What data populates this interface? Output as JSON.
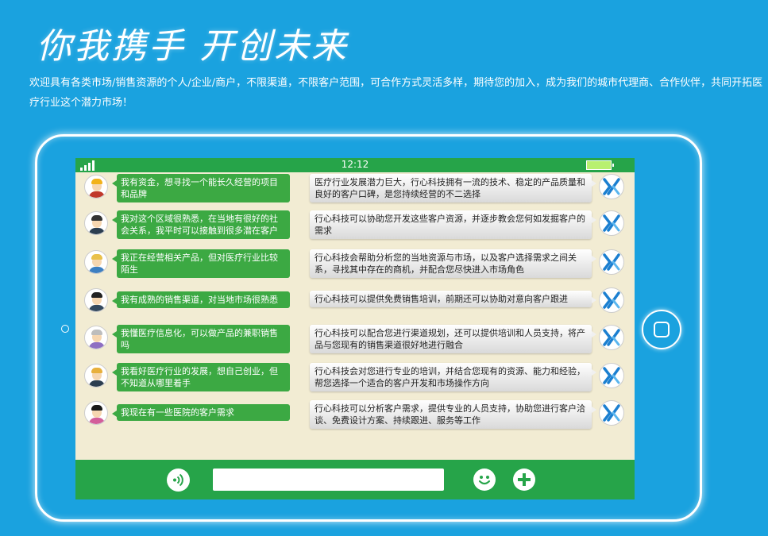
{
  "headline": "你我携手  开创未来",
  "intro": "欢迎具有各类市场/销售资源的个人/企业/商户，不限渠道，不限客户范围，可合作方式灵活多样，期待您的加入，成为我们的城市代理商、合作伙伴，共同开拓医疗行业这个潜力市场！",
  "status": {
    "time": "12:12"
  },
  "messages": [
    {
      "left": "我有资金，想寻找一个能长久经营的项目和品牌",
      "right": "医疗行业发展潜力巨大，行心科技拥有一流的技术、稳定的产品质量和良好的客户口碑，是您持续经营的不二选择"
    },
    {
      "left": "我对这个区域很熟悉，在当地有很好的社会关系，我平时可以接触到很多潜在客户",
      "right": "行心科技可以协助您开发这些客户资源，并逐步教会您何如发掘客户的需求"
    },
    {
      "left": "我正在经营相关产品，但对医疗行业比较陌生",
      "right": "行心科技会帮助分析您的当地资源与市场，以及客户选择需求之间关系，寻找其中存在的商机，并配合您尽快进入市场角色"
    },
    {
      "left": "我有成熟的销售渠道，对当地市场很熟悉",
      "right": "行心科技可以提供免费销售培训，前期还可以协助对意向客户跟进"
    },
    {
      "left": "我懂医疗信息化，可以做产品的兼职销售吗",
      "right": "行心科技可以配合您进行渠道规划，还可以提供培训和人员支持，将产品与您现有的销售渠道很好地进行融合"
    },
    {
      "left": "我看好医疗行业的发展，想自己创业，但不知道从哪里着手",
      "right": "行心科技会对您进行专业的培训，并结合您现有的资源、能力和经验，帮您选择一个适合的客户开发和市场操作方向"
    },
    {
      "left": "我现在有一些医院的客户需求",
      "right": "行心科技可以分析客户需求，提供专业的人员支持，协助您进行客户洽谈、免费设计方案、持续跟进、服务等工作"
    }
  ],
  "avatars": [
    {
      "icon": "construction-worker-avatar-icon",
      "hair": "#f2b21a",
      "body": "#c0392b"
    },
    {
      "icon": "bearded-man-avatar-icon",
      "hair": "#333333",
      "body": "#2c3e50"
    },
    {
      "icon": "blonde-woman-avatar-icon",
      "hair": "#e9c14b",
      "body": "#3d7fc1"
    },
    {
      "icon": "businessman-avatar-icon",
      "hair": "#222222",
      "body": "#34495e"
    },
    {
      "icon": "elderly-man-avatar-icon",
      "hair": "#bdbdbd",
      "body": "#8e6fc2"
    },
    {
      "icon": "blond-man-avatar-icon",
      "hair": "#e8b03c",
      "body": "#2c3e50"
    },
    {
      "icon": "dark-haired-woman-avatar-icon",
      "hair": "#1a1a1a",
      "body": "#d35e9a"
    }
  ],
  "colors": {
    "background": "#1aa2df",
    "bar": "#26a449",
    "bubble_left": "#3ca943",
    "screen": "#f2ecd3",
    "logo": "#1b7fd0"
  },
  "icons": {
    "signal": "signal-icon",
    "battery": "battery-icon",
    "voice": "voice-icon",
    "emoji": "emoji-icon",
    "add": "plus-icon",
    "logo": "xingxin-logo-icon"
  }
}
